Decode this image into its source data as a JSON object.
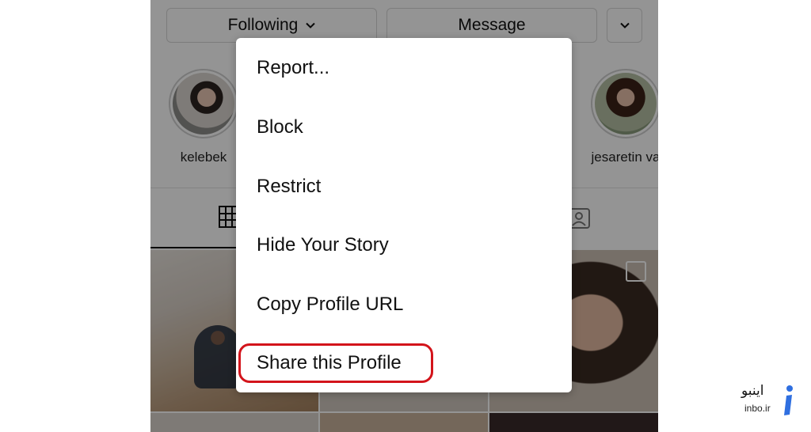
{
  "profile_actions": {
    "following_label": "Following",
    "message_label": "Message"
  },
  "highlights": [
    {
      "label": "kelebek"
    },
    {
      "label": "jesaretin va"
    }
  ],
  "menu": {
    "items": [
      {
        "label": "Report..."
      },
      {
        "label": "Block"
      },
      {
        "label": "Restrict"
      },
      {
        "label": "Hide Your Story"
      },
      {
        "label": "Copy Profile URL"
      },
      {
        "label": "Share this Profile"
      }
    ],
    "highlighted_item": "Share this Profile",
    "highlight_color": "#d3141b"
  },
  "watermark": {
    "text_fa": "اینبو",
    "text_en": "inbo.ir",
    "accent_color": "#2f6fe0"
  },
  "icons": {
    "grid_tab": "grid-icon",
    "tagged_tab": "tagged-icon",
    "following_chevron": "chevron-down-icon",
    "more_chevron": "chevron-down-icon",
    "multi_post": "multiple-posts-icon"
  }
}
